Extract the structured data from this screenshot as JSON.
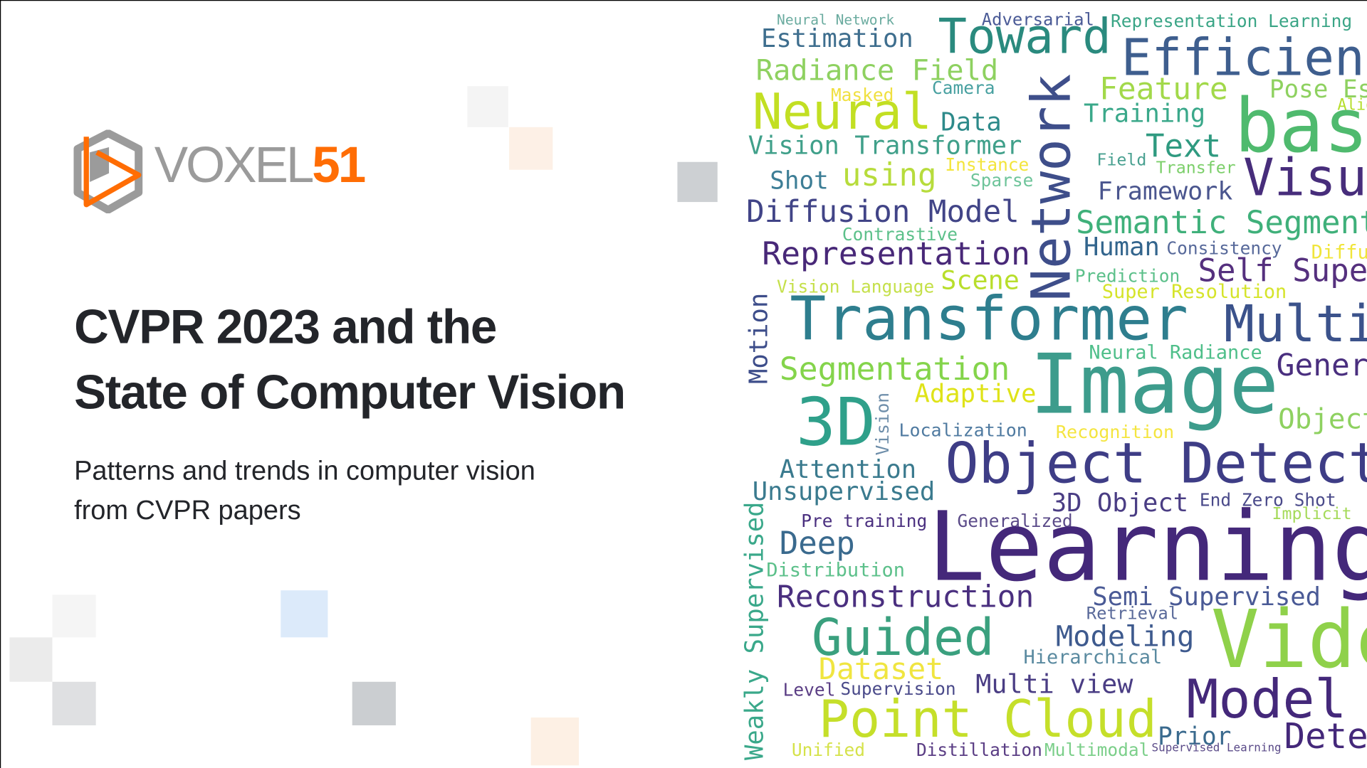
{
  "logo": {
    "name_part1": "VOXEL",
    "name_part2": "51",
    "colors": {
      "gray": "#9b9b9b",
      "orange": "#ff6d04"
    }
  },
  "title": {
    "line1": "CVPR 2023 and the",
    "line2": "State of Computer Vision"
  },
  "subtitle": {
    "line1": "Patterns and trends in computer vision",
    "line2": "from CVPR papers"
  },
  "decor_squares": [
    "#f4f4f4",
    "#fdf0e6",
    "#cdd0d3",
    "#f5f5f5",
    "#ebebeb",
    "#dfe0e2",
    "#dceafa",
    "#cbced1",
    "#fdf0e4"
  ],
  "wordcloud": {
    "words": [
      {
        "text": "Neural Network",
        "color": "#6aab9f"
      },
      {
        "text": "Estimation",
        "color": "#3e6e8e"
      },
      {
        "text": "Toward",
        "color": "#2a8a7e"
      },
      {
        "text": "Adversarial",
        "color": "#4a5a96"
      },
      {
        "text": "Representation Learning",
        "color": "#3aa586"
      },
      {
        "text": "Efficient",
        "color": "#3e5e8e"
      },
      {
        "text": "Radiance Field",
        "color": "#8ed160"
      },
      {
        "text": "Camera",
        "color": "#47a0a0"
      },
      {
        "text": "Masked",
        "color": "#f0e040"
      },
      {
        "text": "Feature",
        "color": "#a2d94a"
      },
      {
        "text": "Pose Estimation",
        "color": "#8ed160"
      },
      {
        "text": "Training",
        "color": "#3aa88a"
      },
      {
        "text": "Alignment",
        "color": "#b5de2b"
      },
      {
        "text": "Neural",
        "color": "#c2df23"
      },
      {
        "text": "Data",
        "color": "#2d8a8a"
      },
      {
        "text": "based",
        "color": "#4fba6e"
      },
      {
        "text": "Vision Transformer",
        "color": "#40a08a"
      },
      {
        "text": "Text",
        "color": "#2f9a80"
      },
      {
        "text": "Field",
        "color": "#48a090"
      },
      {
        "text": "Instance",
        "color": "#f3e53c"
      },
      {
        "text": "Transfer",
        "color": "#7ccf6a"
      },
      {
        "text": "Shot",
        "color": "#3d7e96"
      },
      {
        "text": "using",
        "color": "#b7dc3c"
      },
      {
        "text": "Sparse",
        "color": "#6ec49a"
      },
      {
        "text": "Network",
        "color": "#3e4e8a"
      },
      {
        "text": "Framework",
        "color": "#4a558e"
      },
      {
        "text": "Visual",
        "color": "#472d7b"
      },
      {
        "text": "Diffusion Model",
        "color": "#414487"
      },
      {
        "text": "Semantic Segmentation",
        "color": "#3fb07a"
      },
      {
        "text": "Contrastive",
        "color": "#5cc08a"
      },
      {
        "text": "Representation",
        "color": "#482878"
      },
      {
        "text": "Human",
        "color": "#33658d"
      },
      {
        "text": "Consistency",
        "color": "#57699a"
      },
      {
        "text": "Diffusion",
        "color": "#f0e53a"
      },
      {
        "text": "Prediction",
        "color": "#5cc08a"
      },
      {
        "text": "Self Supervised",
        "color": "#55307e"
      },
      {
        "text": "Vision Language",
        "color": "#c5e04a"
      },
      {
        "text": "Scene",
        "color": "#b8de2b"
      },
      {
        "text": "Super Resolution",
        "color": "#d5e42a"
      },
      {
        "text": "Motion",
        "color": "#3d4d8a"
      },
      {
        "text": "Transformer",
        "color": "#2e7e8e"
      },
      {
        "text": "Multi",
        "color": "#3b528b"
      },
      {
        "text": "Neural Radiance",
        "color": "#4fbf8a"
      },
      {
        "text": "Segmentation",
        "color": "#84d44b"
      },
      {
        "text": "Generation",
        "color": "#4a2f7f"
      },
      {
        "text": "Image",
        "color": "#3d9c8c"
      },
      {
        "text": "Adaptive",
        "color": "#dfe318"
      },
      {
        "text": "3D",
        "color": "#2fa08a"
      },
      {
        "text": "Vision",
        "color": "#6e8eaa"
      },
      {
        "text": "Localization",
        "color": "#4f7aa0"
      },
      {
        "text": "Recognition",
        "color": "#f4e540"
      },
      {
        "text": "Object",
        "color": "#8ed160"
      },
      {
        "text": "Attention",
        "color": "#3a7a8e"
      },
      {
        "text": "Object Detection",
        "color": "#3e3d86"
      },
      {
        "text": "Unsupervised",
        "color": "#3a7a8e"
      },
      {
        "text": "Weakly Supervised",
        "color": "#3aa88a"
      },
      {
        "text": "3D Object",
        "color": "#4a3d84"
      },
      {
        "text": "End Zero Shot",
        "color": "#4a4a8a"
      },
      {
        "text": "Implicit",
        "color": "#a5da5a"
      },
      {
        "text": "Pre training",
        "color": "#4a2f7f"
      },
      {
        "text": "Generalized",
        "color": "#5a4a88"
      },
      {
        "text": "Learning",
        "color": "#44287a"
      },
      {
        "text": "Deep",
        "color": "#3a6a8e"
      },
      {
        "text": "Distribution",
        "color": "#5cc08a"
      },
      {
        "text": "Reconstruction",
        "color": "#4a2f7f"
      },
      {
        "text": "Semi Supervised",
        "color": "#4a5a96"
      },
      {
        "text": "Retrieval",
        "color": "#5a6a9a"
      },
      {
        "text": "Guided",
        "color": "#3aa07e"
      },
      {
        "text": "Modeling",
        "color": "#3e5a8e"
      },
      {
        "text": "Video",
        "color": "#8fd14a"
      },
      {
        "text": "Hierarchical",
        "color": "#5a8aa0"
      },
      {
        "text": "Dataset",
        "color": "#f0e540"
      },
      {
        "text": "Level",
        "color": "#5a3d84"
      },
      {
        "text": "Supervision",
        "color": "#4a4a8a"
      },
      {
        "text": "Multi view",
        "color": "#4a3d84"
      },
      {
        "text": "Model",
        "color": "#44287a"
      },
      {
        "text": "Point Cloud",
        "color": "#c5df2a"
      },
      {
        "text": "Prior",
        "color": "#3a6a8e"
      },
      {
        "text": "Detection",
        "color": "#44287a"
      },
      {
        "text": "Unified",
        "color": "#d5e24a"
      },
      {
        "text": "Distillation",
        "color": "#5a3d84"
      },
      {
        "text": "Multimodal",
        "color": "#7ccf8a"
      },
      {
        "text": "Supervised Learning",
        "color": "#5a4a88"
      }
    ]
  }
}
